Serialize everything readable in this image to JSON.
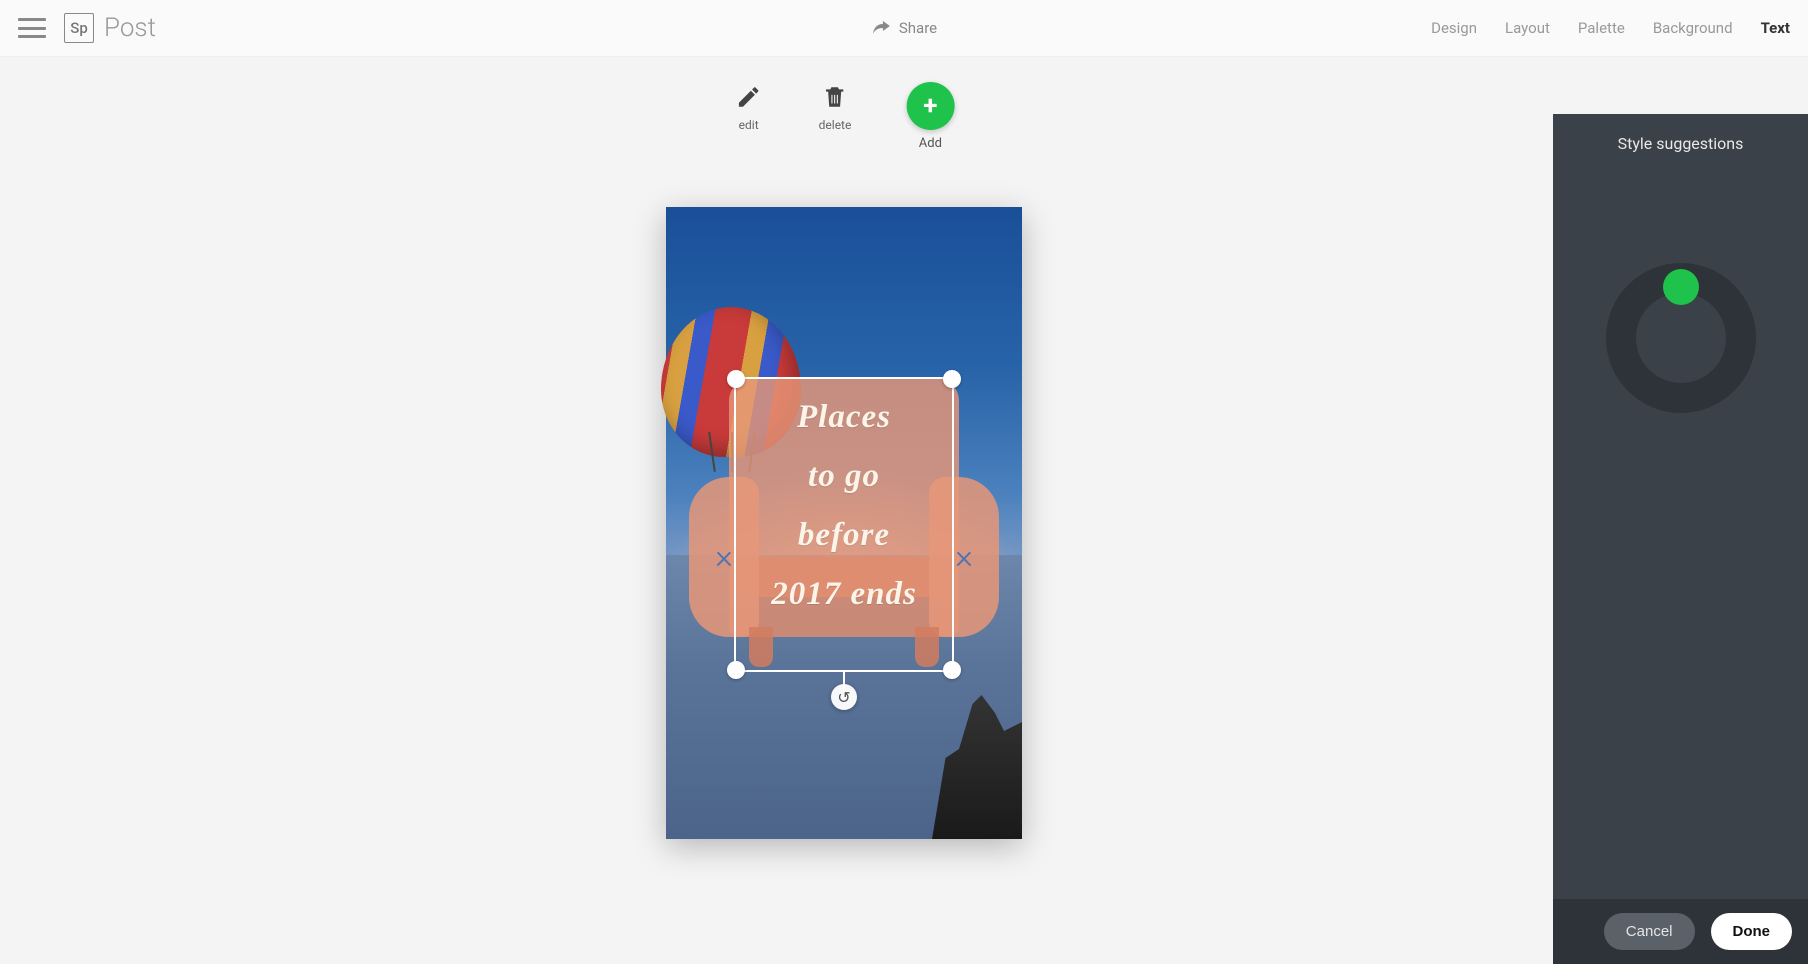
{
  "app": {
    "logo_text": "Sp",
    "title": "Post"
  },
  "share": {
    "label": "Share"
  },
  "tabs": {
    "design": "Design",
    "layout": "Layout",
    "palette": "Palette",
    "background": "Background",
    "text": "Text"
  },
  "toolbar": {
    "edit_label": "edit",
    "delete_label": "delete",
    "add_label": "Add"
  },
  "canvas": {
    "text_lines": [
      "Places",
      "to go",
      "before",
      "2017 ends"
    ]
  },
  "panel": {
    "title": "Style suggestions",
    "cancel_label": "Cancel",
    "done_label": "Done"
  },
  "colors": {
    "accent_green": "#1fc24a",
    "panel_bg": "#3a4148",
    "panel_footer_bg": "#2d3339"
  }
}
